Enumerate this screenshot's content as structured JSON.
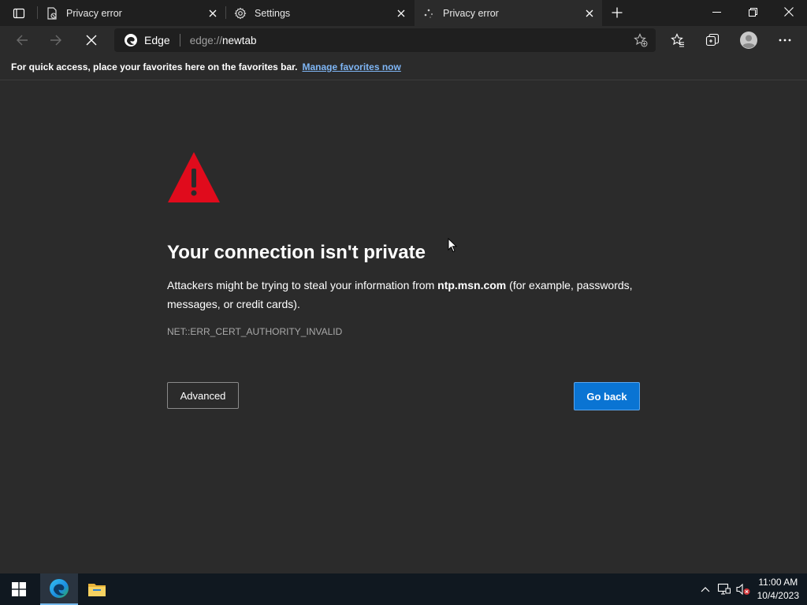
{
  "browser": {
    "tabs": [
      {
        "title": "Privacy error",
        "active": false
      },
      {
        "title": "Settings",
        "active": false
      },
      {
        "title": "Privacy error",
        "active": true
      }
    ],
    "address": {
      "site_label": "Edge",
      "url_scheme": "edge://",
      "url_rest": "newtab"
    },
    "favorites_bar": {
      "text": "For quick access, place your favorites here on the favorites bar.",
      "link": "Manage favorites now"
    }
  },
  "page": {
    "heading": "Your connection isn't private",
    "desc_prefix": "Attackers might be trying to steal your information from ",
    "desc_host": "ntp.msn.com",
    "desc_suffix": " (for example, passwords, messages, or credit cards).",
    "error_code": "NET::ERR_CERT_AUTHORITY_INVALID",
    "advanced_label": "Advanced",
    "go_back_label": "Go back"
  },
  "taskbar": {
    "time": "11:00 AM",
    "date": "10/4/2023"
  },
  "colors": {
    "warning_red": "#e00b1c",
    "primary_blue": "#0a74d3",
    "link_blue": "#7fb6f5"
  }
}
